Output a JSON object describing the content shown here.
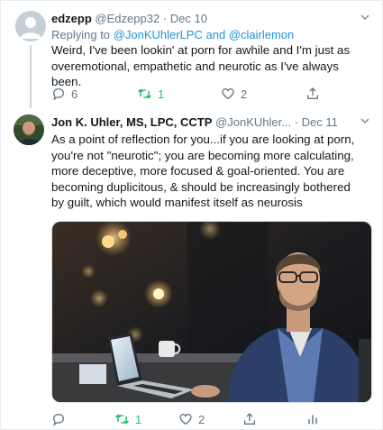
{
  "tweet1": {
    "display_name": "edzepp",
    "handle": "@Edzepp32",
    "separator": "·",
    "date": "Dec 10",
    "replying_prefix": "Replying to",
    "replying_to_1": "@JonKUhlerLPC",
    "replying_and": "and",
    "replying_to_2": "@clairlemon",
    "body": "Weird, I've been lookin' at porn for awhile and I'm just as overemotional, empathetic and neurotic as I've always been.",
    "reply_count": "6",
    "retweet_count": "1",
    "like_count": "2"
  },
  "tweet2": {
    "display_name": "Jon K. Uhler, MS, LPC, CCTP",
    "handle": "@JonKUhler...",
    "separator": "·",
    "date": "Dec 11",
    "body": "As a point of reflection for you...if you are looking at porn, you're not \"neurotic\"; you are becoming more calculating, more deceptive, more focused & goal-oriented. You are becoming duplicitous, & should be increasingly bothered by guilt, which would manifest itself as neurosis",
    "reply_count": "",
    "retweet_count": "1",
    "like_count": "2"
  },
  "icons": {
    "chevron": "chevron-down-icon",
    "reply": "reply-icon",
    "retweet": "retweet-icon",
    "like": "heart-icon",
    "share": "share-icon",
    "analytics": "analytics-icon"
  },
  "colors": {
    "link": "#1b95e0",
    "muted": "#657786",
    "retweeted": "#17bf63",
    "thread_line": "#ccd6dd"
  }
}
